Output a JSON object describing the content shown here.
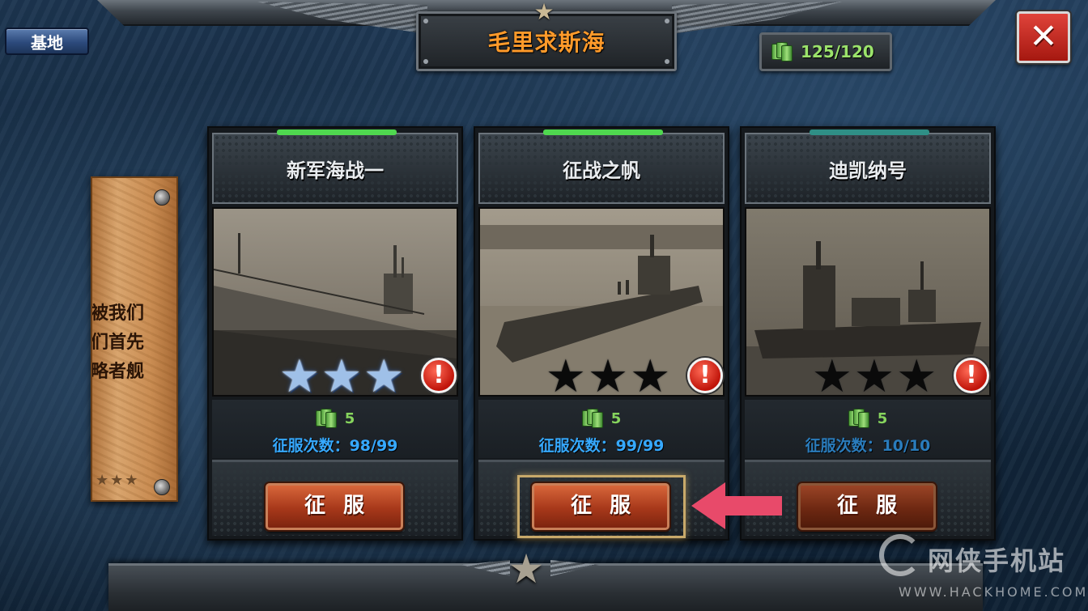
{
  "header": {
    "base_button_label": "基地",
    "region_title": "毛里求斯海",
    "resource_display": "125/120",
    "close_icon": "close-x-icon"
  },
  "story_scroll": {
    "lines": [
      "经被我们",
      "我们首先",
      "侵略者舰"
    ],
    "stars": "★★★"
  },
  "missions": [
    {
      "title": "新军海战一",
      "stars_earned": 3,
      "stars_total": 3,
      "cost": "5",
      "conquer_count": "征服次数：98/99",
      "button_label": "征服",
      "header_glow_color": "#4fd84f"
    },
    {
      "title": "征战之帆",
      "stars_earned": 0,
      "stars_total": 3,
      "cost": "5",
      "conquer_count": "征服次数：99/99",
      "button_label": "征服",
      "header_glow_color": "#4fd84f"
    },
    {
      "title": "迪凯纳号",
      "stars_earned": 0,
      "stars_total": 3,
      "cost": "5",
      "conquer_count": "征服次数：10/10",
      "button_label": "征服",
      "header_glow_color": "#2f8f86"
    }
  ],
  "watermark": {
    "name": "网侠手机站",
    "url": "WWW.HACKHOME.COM"
  },
  "colors": {
    "title_orange": "#ff9a2a",
    "resource_green": "#9be36b",
    "count_blue": "#36a9ff",
    "button_red": "#a7381a"
  }
}
